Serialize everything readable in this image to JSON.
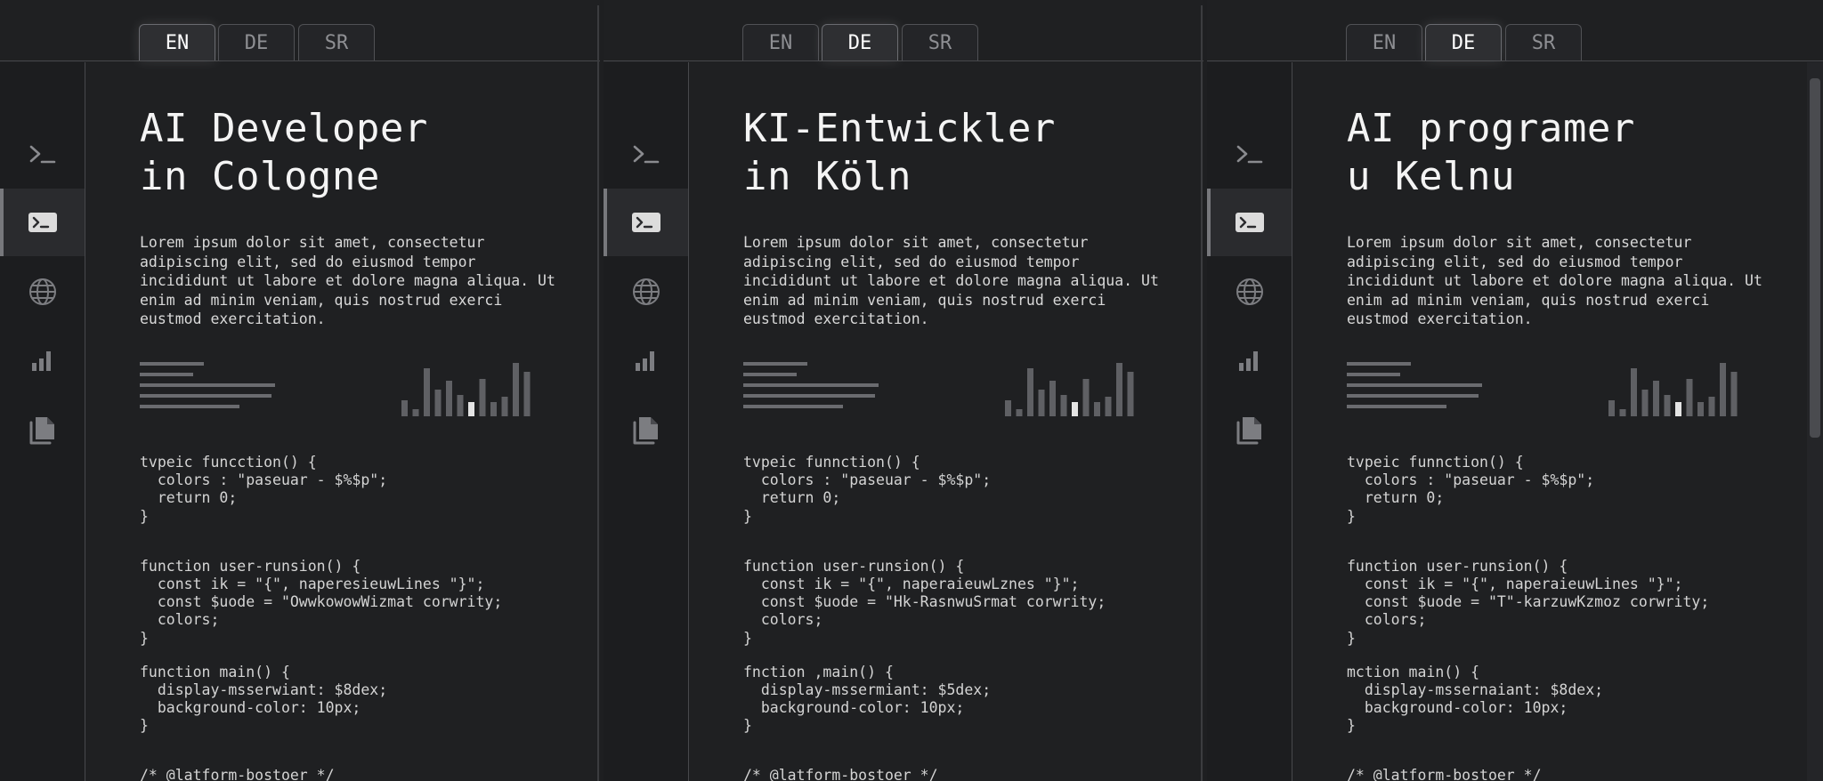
{
  "tabs": [
    "EN",
    "DE",
    "SR"
  ],
  "sidebar_icons": [
    "terminal-icon",
    "terminal-window-icon",
    "globe-icon",
    "bar-chart-icon",
    "documents-icon"
  ],
  "colors": {
    "background": "#1f2022",
    "accent": "#ffffff",
    "text": "#e6e6e6",
    "muted": "#8e8f93"
  },
  "panels": [
    {
      "active_tab": "EN",
      "title_line1": "AI Developer",
      "title_line2": "in Cologne",
      "lorem": [
        "Lorem ipsum dolor sit amet, consectetur",
        "adipiscing elit, sed do eiusmod tempor",
        "incididunt ut labore et dolore magna aliqua. Ut",
        "enim ad minim veniam, quis nostrud exerci",
        "eustmod exercitation."
      ],
      "code_blocks": [
        [
          "tvpeic funcction() {",
          "  colors : \"paseuar - $%$p\";",
          "  return 0;",
          "}"
        ],
        [
          "function user-runsion() {",
          "  const ik = \"{\", naperesieuwLines \"}\";",
          "  const $uode = \"OwwkowowWizmat corwrity;",
          "  colors;",
          "}"
        ],
        [
          "function main() {",
          "  display-msserwiant: $8dex;",
          "  background-color: 10px;",
          "}"
        ],
        [
          "/* @latform-bostoer */"
        ]
      ]
    },
    {
      "active_tab": "DE",
      "title_line1": "KI-Entwickler",
      "title_line2": "in Köln",
      "lorem": [
        "Lorem ipsum dolor sit amet, consectetur",
        "adipiscing elit, sed do eiusmod tempor",
        "incididunt ut labore et dolore magna aliqua. Ut",
        "enim ad minim veniam, quis nostrud exerci",
        "eustmod exercitation."
      ],
      "code_blocks": [
        [
          "tvpeic funnction() {",
          "  colors : \"paseuar - $%$p\";",
          "  return 0;",
          "}"
        ],
        [
          "function user-runsion() {",
          "  const ik = \"{\", naperaieuwLznes \"}\";",
          "  const $uode = \"Hk-RasnwuSrmat corwrity;",
          "  colors;",
          "}"
        ],
        [
          "fnction ,main() {",
          "  display-mssermiant: $5dex;",
          "  background-color: 10px;",
          "}"
        ],
        [
          "/* @latform-bostoer */"
        ]
      ]
    },
    {
      "active_tab": "DE",
      "title_line1": "AI programer",
      "title_line2": "u Kelnu",
      "lorem": [
        "Lorem ipsum dolor sit amet, consectetur",
        "adipiscing elit, sed do eiusmod tempor",
        "incididunt ut labore et dolore magna aliqua. Ut",
        "enim ad minim veniam, quis nostrud exerci",
        "eustmod exercitation."
      ],
      "code_blocks": [
        [
          "tvpeic funnction() {",
          "  colors : \"paseuar - $%$p\";",
          "  return 0;",
          "}"
        ],
        [
          "function user-runsion() {",
          "  const ik = \"{\", naperaieuwLines \"}\";",
          "  const $uode = \"T\"-karzuwKzmoz corwrity;",
          "  colors;",
          "}"
        ],
        [
          "mction main() {",
          "  display-mssernaiant: $8dex;",
          "  background-color: 10px;",
          "}"
        ],
        [
          "/* @latform-bostoer */"
        ]
      ]
    }
  ]
}
